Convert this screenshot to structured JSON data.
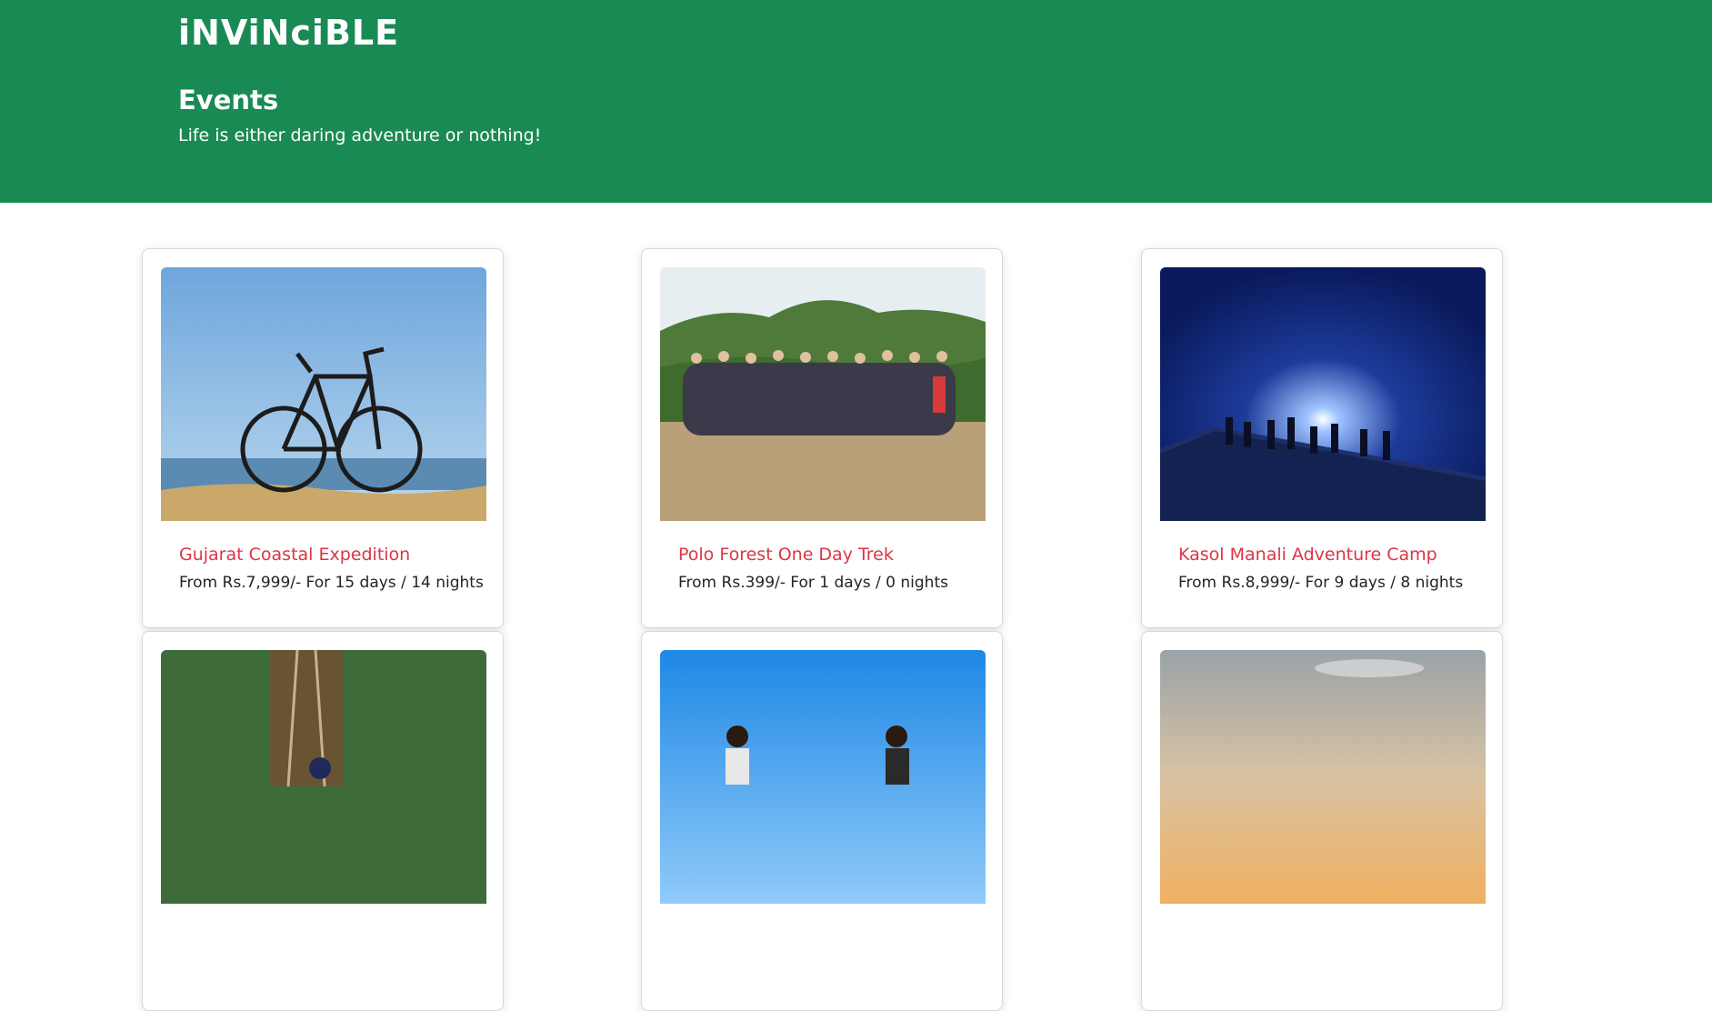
{
  "brand": {
    "name": "iNViNciBLE"
  },
  "header": {
    "title": "Events",
    "subtitle": "Life is either daring adventure or nothing!"
  },
  "events": [
    {
      "title": "Gujarat Coastal Expedition",
      "info": "From Rs.7,999/- For 15 days / 14 nights",
      "image": "bicycle-on-beach-photo"
    },
    {
      "title": "Polo Forest One Day Trek",
      "info": "From Rs.399/- For 1 days / 0 nights",
      "image": "group-photo-forest"
    },
    {
      "title": "Kasol Manali Adventure Camp",
      "info": "From Rs.8,999/- For 9 days / 8 nights",
      "image": "silhouettes-night-sky"
    },
    {
      "title": "",
      "info": "",
      "image": "rope-bridge-photo"
    },
    {
      "title": "",
      "info": "",
      "image": "people-on-beach-photo"
    },
    {
      "title": "",
      "info": "",
      "image": "sunset-sky-photo"
    }
  ],
  "colors": {
    "header_bg": "#1a8a55",
    "title_red": "#dc3545",
    "text": "#212529"
  }
}
